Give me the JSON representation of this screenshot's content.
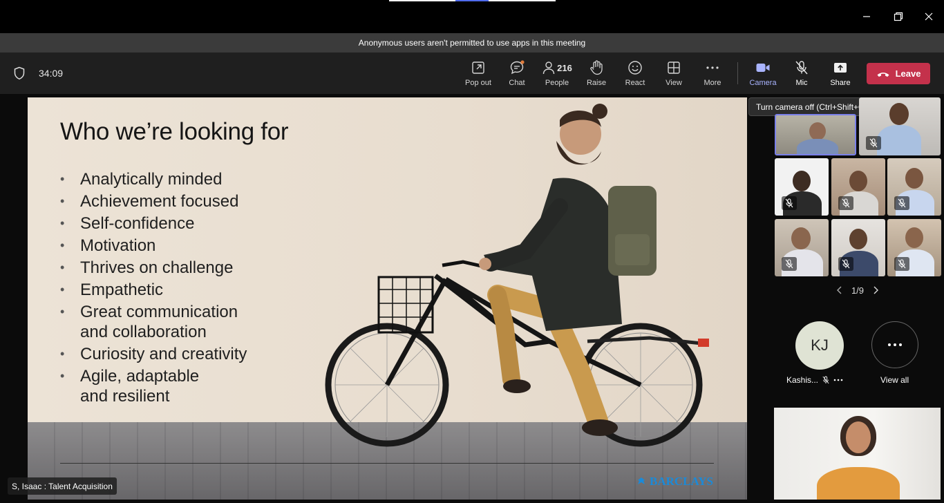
{
  "notice": "Anonymous users aren't permitted to use apps in this meeting",
  "meeting": {
    "timer": "34:09"
  },
  "toolbar": {
    "popout": "Pop out",
    "chat": "Chat",
    "people_count": "216",
    "people": "People",
    "raise": "Raise",
    "react": "React",
    "view": "View",
    "more": "More",
    "camera": "Camera",
    "mic": "Mic",
    "share": "Share",
    "leave": "Leave",
    "accent": "#a9b4ff",
    "leave_color": "#c4314b"
  },
  "tooltip": "Turn camera off (Ctrl+Shift+O)",
  "slide": {
    "title": "Who we’re looking for",
    "bullets": [
      "Analytically minded",
      "Achievement focused",
      "Self-confidence",
      "Motivation",
      "Thrives on challenge",
      "Empathetic",
      "Great communication and collaboration",
      "Curiosity and creativity",
      "Agile, adaptable and resilient"
    ],
    "brand": "BARCLAYS"
  },
  "presenter_label": "S, Isaac : Talent Acquisition",
  "pagination": "1/9",
  "participant": {
    "initials": "KJ",
    "name": "Kashis..."
  },
  "view_all": "View all"
}
